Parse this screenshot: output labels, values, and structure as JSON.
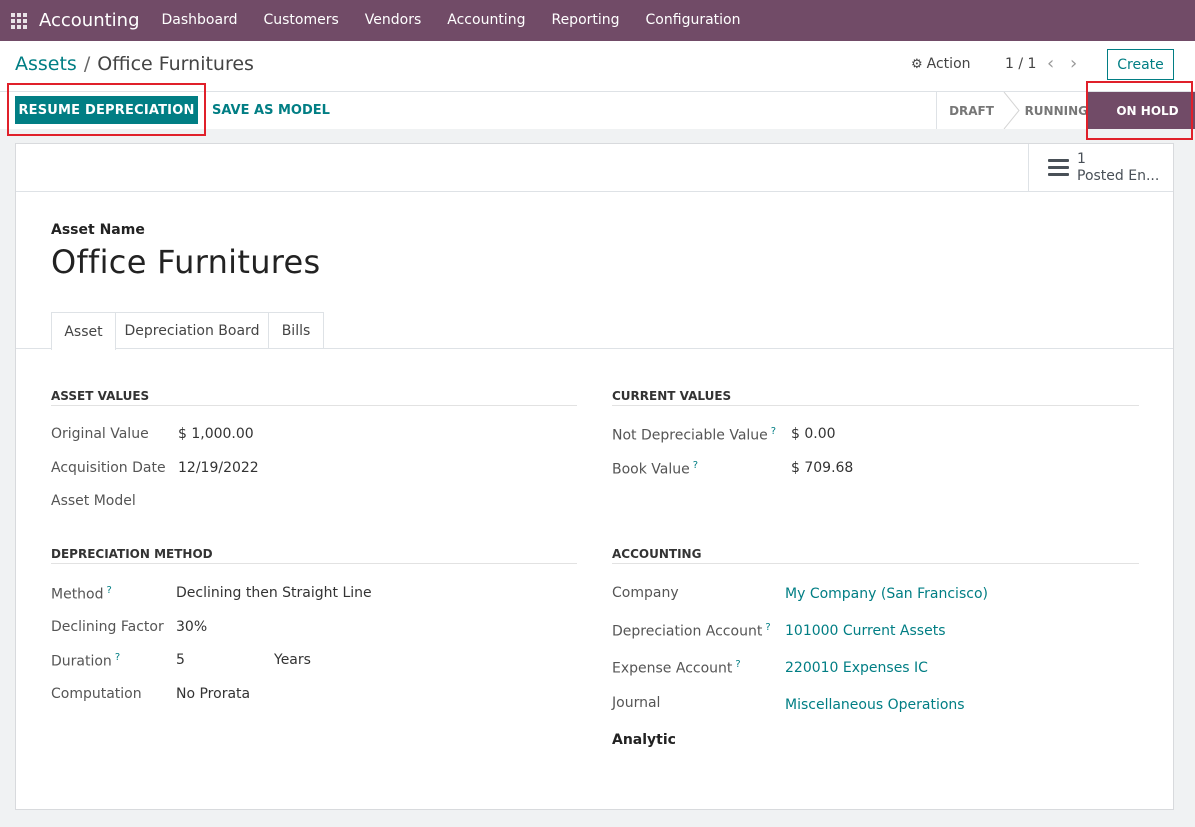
{
  "navbar": {
    "brand": "Accounting",
    "menu": [
      "Dashboard",
      "Customers",
      "Vendors",
      "Accounting",
      "Reporting",
      "Configuration"
    ]
  },
  "breadcrumb": {
    "parent": "Assets",
    "separator": "/",
    "current": "Office Furnitures"
  },
  "control": {
    "action_label": "Action",
    "pager": "1 / 1",
    "create_label": "Create"
  },
  "buttons": {
    "resume": "RESUME DEPRECIATION",
    "save_model": "SAVE AS MODEL"
  },
  "status": {
    "stages": [
      "DRAFT",
      "RUNNING",
      "ON HOLD"
    ],
    "current": "ON HOLD"
  },
  "smart_button": {
    "count": "1",
    "label": "Posted En..."
  },
  "asset": {
    "name_label": "Asset Name",
    "name": "Office Furnitures"
  },
  "tabs": [
    "Asset",
    "Depreciation Board",
    "Bills"
  ],
  "asset_values": {
    "title": "ASSET VALUES",
    "original_value_label": "Original Value",
    "original_value": "$ 1,000.00",
    "acquisition_date_label": "Acquisition Date",
    "acquisition_date": "12/19/2022",
    "asset_model_label": "Asset Model"
  },
  "current_values": {
    "title": "CURRENT VALUES",
    "not_depreciable_label": "Not Depreciable Value",
    "not_depreciable": "$ 0.00",
    "book_value_label": "Book Value",
    "book_value": "$ 709.68"
  },
  "depreciation_method": {
    "title": "DEPRECIATION METHOD",
    "method_label": "Method",
    "method": "Declining then Straight Line",
    "factor_label": "Declining Factor",
    "factor": "30%",
    "duration_label": "Duration",
    "duration": "5",
    "duration_unit": "Years",
    "computation_label": "Computation",
    "computation": "No Prorata"
  },
  "accounting": {
    "title": "ACCOUNTING",
    "company_label": "Company",
    "company": "My Company (San Francisco)",
    "depreciation_account_label": "Depreciation Account",
    "depreciation_account": "101000 Current Assets",
    "expense_account_label": "Expense Account",
    "expense_account": "220010 Expenses IC",
    "journal_label": "Journal",
    "journal": "Miscellaneous Operations",
    "analytic_label": "Analytic"
  },
  "help_marker": "?",
  "icons": {
    "apps": "apps-grid-icon",
    "gear": "gear-icon",
    "prev": "chevron-left-icon",
    "next": "chevron-right-icon",
    "smart": "bars-icon"
  },
  "colors": {
    "brand": "#714b67",
    "accent": "#017e84",
    "highlight": "#e0202a"
  }
}
